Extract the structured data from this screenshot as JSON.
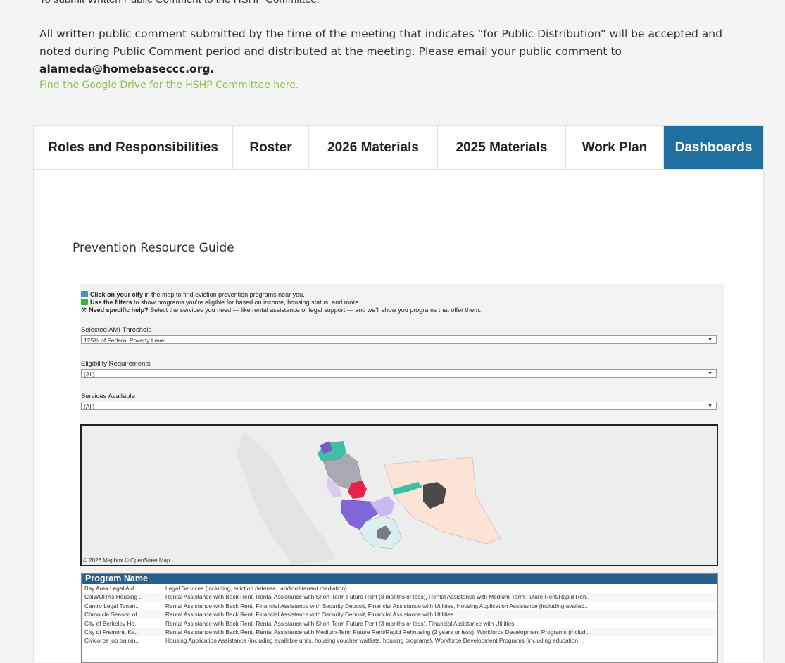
{
  "top_cut_text": "To submit Written Public Comment to the HSHP Committee:",
  "intro": {
    "text": "All written public comment submitted by the time of the meeting that indicates “for Public Distribution” will be accepted and noted during Public Comment period and distributed at the meeting. Please email your public comment to ",
    "email": "alameda@homebaseccc.org."
  },
  "drive_link": "Find the Google Drive for the HSHP Committee here.",
  "tabs": [
    {
      "label": "Roles and Responsibilities",
      "active": false
    },
    {
      "label": "Roster",
      "active": false
    },
    {
      "label": "2026 Materials",
      "active": false
    },
    {
      "label": "2025 Materials",
      "active": false
    },
    {
      "label": "Work Plan",
      "active": false
    },
    {
      "label": "Dashboards",
      "active": true
    }
  ],
  "accent_color": "#1f6fa1",
  "guide_title": "Prevention Resource Guide",
  "instructions": {
    "line1_bold": "Click on your city",
    "line1_rest": " in the map to find eviction prevention programs near you.",
    "line2_bold": "Use the filters",
    "line2_rest": " to show programs you’re eligible for based on income, housing status, and more.",
    "line3_bold": "Need specific help?",
    "line3_rest": " Select the services you need — like rental assistance or legal support — and we’ll show you programs that offer them."
  },
  "filters": {
    "ami_label": "Selected AMI Threshold",
    "ami_value": "125% of Federal Poverty Level",
    "elig_label": "Eligibility Requirements",
    "elig_value": "(All)",
    "svc_label": "Services Available",
    "svc_value": "(All)"
  },
  "map_credit": "© 2026 Mapbox  © OpenStreetMap",
  "table": {
    "header": "Program Name",
    "rows": [
      {
        "name": "Bay Area Legal Aid",
        "services": "Legal Services (including, eviction defense, landlord-tenant mediation)"
      },
      {
        "name": "CalWORKs Housing ..",
        "services": "Rental Assistance with Back Rent, Rental Assistance with Short-Term Future Rent (3 months or less), Rental Assistance with Medium-Term Future Rent/Rapid Reh.."
      },
      {
        "name": "Centro Legal Tenan..",
        "services": "Rental Assistance with Back Rent, Financial Assistance with Security Deposit, Financial Assistance with Utilities, Housing Application Assistance (including availab.."
      },
      {
        "name": "Chronicle Season of..",
        "services": "Rental Assistance with Back Rent, Financial Assistance with Security Deposit, Financial Assistance with Utilities"
      },
      {
        "name": "City of Berkeley Ho..",
        "services": "Rental Assistance with Back Rent, Rental Assistance with Short-Term Future Rent (3 months or less), Financial Assistance with Utilities"
      },
      {
        "name": "City of Fremont, Ke..",
        "services": "Rental Assistance with Back Rent, Rental Assistance with Medium-Term Future Rent/Rapid Rehousing (2 years or less), Workforce Development Programs (includi.."
      },
      {
        "name": "Civicorps job trainin..",
        "services": "Housing Application Assistance (including available units, housing voucher waitlists, housing programs), Workforce Development Programs (including education, .."
      }
    ]
  }
}
